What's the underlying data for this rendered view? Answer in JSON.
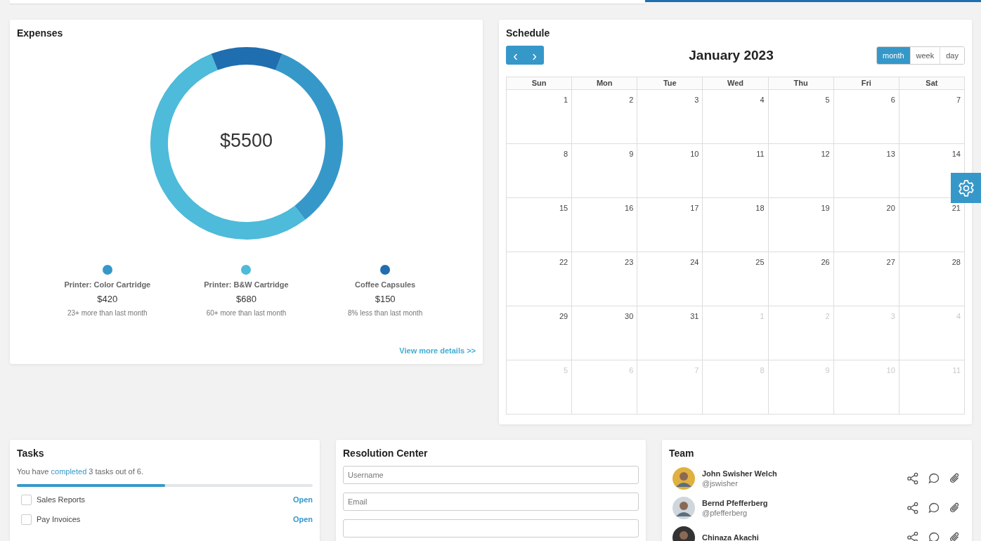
{
  "expenses": {
    "title": "Expenses",
    "total": "$5500",
    "items": [
      {
        "name": "Printer: Color Cartridge",
        "amount": "$420",
        "note": "23+ more than last month",
        "color": "#3698c9"
      },
      {
        "name": "Printer: B&W Cartridge",
        "amount": "$680",
        "note": "60+ more than last month",
        "color": "#4dbbd9"
      },
      {
        "name": "Coffee Capsules",
        "amount": "$150",
        "note": "8% less than last month",
        "color": "#1f6eb0"
      }
    ],
    "link": "View more details >>"
  },
  "schedule": {
    "title": "Schedule",
    "prev": "‹",
    "next": "›",
    "month": "January 2023",
    "views": [
      {
        "label": "month",
        "selected": true
      },
      {
        "label": "week",
        "selected": false
      },
      {
        "label": "day",
        "selected": false
      }
    ],
    "weekdays": [
      "Sun",
      "Mon",
      "Tue",
      "Wed",
      "Thu",
      "Fri",
      "Sat"
    ],
    "days": [
      {
        "day": "1",
        "other_month": false
      },
      {
        "day": "2",
        "other_month": false
      },
      {
        "day": "3",
        "other_month": false
      },
      {
        "day": "4",
        "other_month": false
      },
      {
        "day": "5",
        "other_month": false
      },
      {
        "day": "6",
        "other_month": false
      },
      {
        "day": "7",
        "other_month": false
      },
      {
        "day": "8",
        "other_month": false
      },
      {
        "day": "9",
        "other_month": false
      },
      {
        "day": "10",
        "other_month": false
      },
      {
        "day": "11",
        "other_month": false
      },
      {
        "day": "12",
        "other_month": false
      },
      {
        "day": "13",
        "other_month": false
      },
      {
        "day": "14",
        "other_month": false
      },
      {
        "day": "15",
        "other_month": false
      },
      {
        "day": "16",
        "other_month": false
      },
      {
        "day": "17",
        "other_month": false
      },
      {
        "day": "18",
        "other_month": false
      },
      {
        "day": "19",
        "other_month": false
      },
      {
        "day": "20",
        "other_month": false
      },
      {
        "day": "21",
        "other_month": false
      },
      {
        "day": "22",
        "other_month": false
      },
      {
        "day": "23",
        "other_month": false
      },
      {
        "day": "24",
        "other_month": false
      },
      {
        "day": "25",
        "other_month": false
      },
      {
        "day": "26",
        "other_month": false
      },
      {
        "day": "27",
        "other_month": false
      },
      {
        "day": "28",
        "other_month": false
      },
      {
        "day": "29",
        "other_month": false
      },
      {
        "day": "30",
        "other_month": false
      },
      {
        "day": "31",
        "other_month": false
      },
      {
        "day": "1",
        "other_month": true
      },
      {
        "day": "2",
        "other_month": true
      },
      {
        "day": "3",
        "other_month": true
      },
      {
        "day": "4",
        "other_month": true
      },
      {
        "day": "5",
        "other_month": true
      },
      {
        "day": "6",
        "other_month": true
      },
      {
        "day": "7",
        "other_month": true
      },
      {
        "day": "8",
        "other_month": true
      },
      {
        "day": "9",
        "other_month": true
      },
      {
        "day": "10",
        "other_month": true
      },
      {
        "day": "11",
        "other_month": true
      }
    ]
  },
  "tasks": {
    "title": "Tasks",
    "summary": "You have",
    "summary_link": "completed",
    "summary_end": "3 tasks out of 6.",
    "level": 0.5,
    "items": [
      {
        "label": "Sales Reports",
        "checked": false,
        "action": "Open"
      },
      {
        "label": "Pay Invoices",
        "checked": false,
        "action": "Open"
      }
    ]
  },
  "resolution": {
    "title": "Resolution Center",
    "fields": [
      {
        "kind": "input",
        "placeholder": "Username"
      },
      {
        "kind": "input",
        "placeholder": "Email"
      },
      {
        "kind": "input"
      }
    ]
  },
  "team": {
    "title": "Team",
    "members": [
      {
        "name": "John Swisher Welch",
        "handle": "@jswisher"
      },
      {
        "name": "Bernd Pfefferberg",
        "handle": "@pfefferberg"
      },
      {
        "name": "Chinaza Akachi"
      }
    ]
  }
}
